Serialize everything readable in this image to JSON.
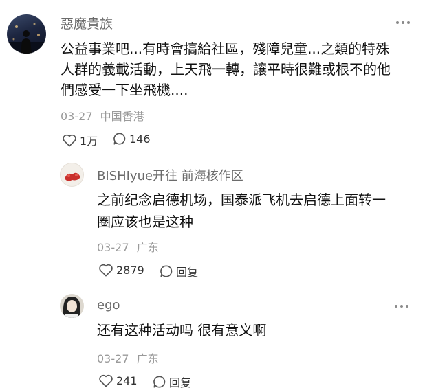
{
  "comments": [
    {
      "username": "惡魔貴族",
      "lines": [
        "公益事業吧...有時會搞給社區，殘障兒童...之類的特殊",
        "人群的義載活動，上天飛一轉，讓平時很難或根不的他",
        "們感受一下坐飛機...."
      ],
      "date": "03-27",
      "location": "中国香港",
      "likes": "1万",
      "replies": "146",
      "more_icon": "more-dots-icon"
    }
  ],
  "replies": [
    {
      "username": "BISHIyue开往 前海核作区",
      "lines": [
        "之前纪念启德机场，国泰派飞机去启德上面转一",
        "圈应该也是这种"
      ],
      "date": "03-27",
      "location": "广东",
      "likes": "2879",
      "reply_label": "回复"
    },
    {
      "username": "ego",
      "lines": [
        "还有这种活动吗 很有意义啊"
      ],
      "date": "03-27",
      "location": "广东",
      "likes": "241",
      "reply_label": "回复"
    }
  ],
  "colors": {
    "username": "#6b6b6b",
    "meta": "#9a9a9a",
    "text": "#111111",
    "icon": "#555555"
  }
}
